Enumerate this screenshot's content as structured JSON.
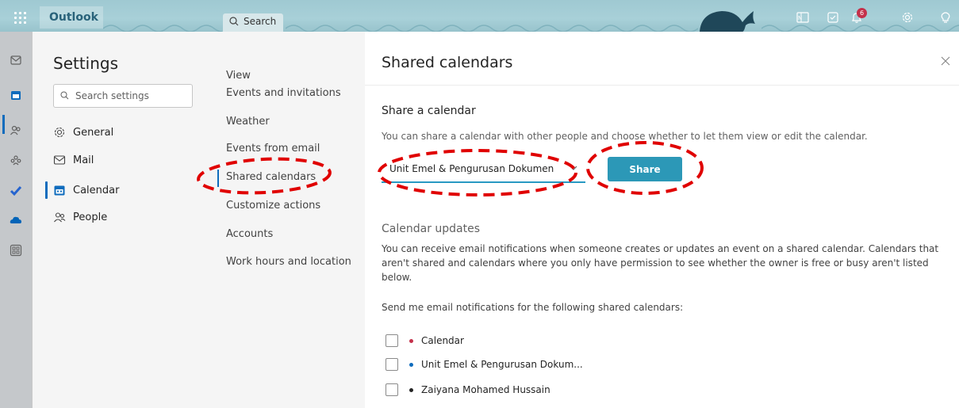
{
  "topbar": {
    "app_name": "Outlook",
    "search_placeholder": "Search",
    "notification_count": "6"
  },
  "settings_nav": {
    "title": "Settings",
    "search_placeholder": "Search settings",
    "items": [
      {
        "label": "General",
        "icon": "gear-icon"
      },
      {
        "label": "Mail",
        "icon": "mail-icon"
      },
      {
        "label": "Calendar",
        "icon": "calendar-icon"
      },
      {
        "label": "People",
        "icon": "people-icon"
      }
    ]
  },
  "calendar_nav": {
    "items": [
      {
        "label": "View"
      },
      {
        "label": "Events and invitations"
      },
      {
        "label": "Weather"
      },
      {
        "label": "Events from email"
      },
      {
        "label": "Shared calendars"
      },
      {
        "label": "Customize actions"
      },
      {
        "label": "Accounts"
      },
      {
        "label": "Work hours and location"
      }
    ]
  },
  "content": {
    "title": "Shared calendars",
    "share_heading": "Share a calendar",
    "share_description": "You can share a calendar with other people and choose whether to let them view or edit the calendar.",
    "calendar_select_value": "Unit Emel & Pengurusan Dokumen",
    "share_button": "Share",
    "updates_heading": "Calendar updates",
    "updates_description": "You can receive email notifications when someone creates or updates an event on a shared calendar. Calendars that aren't shared and calendars where you only have permission to see whether the owner is free or busy aren't listed below.",
    "notify_label": "Send me email notifications for the following shared calendars:",
    "calendars": [
      {
        "name": "Calendar",
        "color": "#c4314b"
      },
      {
        "name": "Unit Emel & Pengurusan Dokum...",
        "color": "#0f6cbd"
      },
      {
        "name": "Zaiyana Mohamed Hussain",
        "color": "#242424"
      }
    ]
  },
  "colors": {
    "accent": "#0f6cbd",
    "share_button": "#2c98b7",
    "annotation": "#e00000"
  }
}
